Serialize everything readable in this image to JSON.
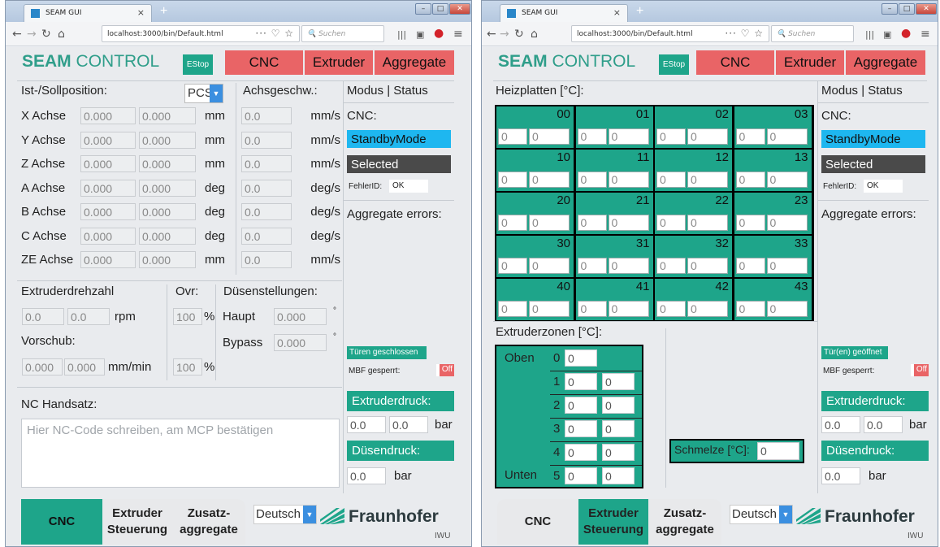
{
  "browser": {
    "tab_title": "SEAM GUI",
    "tab_close": "×",
    "new_tab": "+",
    "url": "localhost:3000/bin/Default.html",
    "url_menu": "··· ♡ ☆",
    "search_placeholder": "Suchen"
  },
  "header": {
    "logo_bold": "SEAM",
    "logo_rest": " CONTROL",
    "estop": "EStop",
    "btn_cnc": "CNC",
    "btn_extruder": "Extruder",
    "btn_aggregate": "Aggregate"
  },
  "left": {
    "pos_title": "Ist-/Sollposition:",
    "pcs": "PCS",
    "speed_title": "Achsgeschw.:",
    "axes": [
      {
        "name": "X Achse",
        "ist": "0.000",
        "soll": "0.000",
        "unit": "mm",
        "speed": "0.0",
        "speed_unit": "mm/s"
      },
      {
        "name": "Y Achse",
        "ist": "0.000",
        "soll": "0.000",
        "unit": "mm",
        "speed": "0.0",
        "speed_unit": "mm/s"
      },
      {
        "name": "Z Achse",
        "ist": "0.000",
        "soll": "0.000",
        "unit": "mm",
        "speed": "0.0",
        "speed_unit": "mm/s"
      },
      {
        "name": "A Achse",
        "ist": "0.000",
        "soll": "0.000",
        "unit": "deg",
        "speed": "0.0",
        "speed_unit": "deg/s"
      },
      {
        "name": "B Achse",
        "ist": "0.000",
        "soll": "0.000",
        "unit": "deg",
        "speed": "0.0",
        "speed_unit": "deg/s"
      },
      {
        "name": "C Achse",
        "ist": "0.000",
        "soll": "0.000",
        "unit": "deg",
        "speed": "0.0",
        "speed_unit": "deg/s"
      },
      {
        "name": "ZE Achse",
        "ist": "0.000",
        "soll": "0.000",
        "unit": "mm",
        "speed": "0.0",
        "speed_unit": "mm/s"
      }
    ],
    "extruder_speed_title": "Extruderdrehzahl",
    "ovr_title": "Ovr:",
    "nozzle_title": "Düsenstellungen:",
    "rpm_ist": "0.0",
    "rpm_soll": "0.0",
    "rpm_unit": "rpm",
    "ovr1": "100",
    "pct": "%",
    "haupt_label": "Haupt",
    "haupt_val": "0.000",
    "deg_sym": "°",
    "vorschub_title": "Vorschub:",
    "bypass_label": "Bypass",
    "bypass_val": "0.000",
    "feed_ist": "0.000",
    "feed_soll": "0.000",
    "feed_unit": "mm/min",
    "ovr2": "100",
    "nc_title": "NC Handsatz:",
    "nc_placeholder": "Hier NC-Code schreiben, am MCP bestätigen"
  },
  "status": {
    "title": "Modus | Status",
    "cnc_label": "CNC:",
    "mode": "StandbyMode",
    "selected": "Selected",
    "fehler_label": "FehlerID:",
    "fehler_val": "OK",
    "agg_errors": "Aggregate errors:",
    "door_left": "Türen geschlossen",
    "door_right": "Tür(en) geöffnet",
    "mbf_label": "MBF gesperrt:",
    "mbf_val": "Off",
    "extr_pressure_title": "Extruderdruck:",
    "extr_p1": "0.0",
    "extr_p2": "0.0",
    "bar": "bar",
    "nozzle_pressure_title": "Düsendruck:",
    "nozzle_p": "0.0"
  },
  "extruder": {
    "heat_title": "Heizplatten [°C]:",
    "plates": [
      {
        "id": "00",
        "a": "0",
        "b": "0"
      },
      {
        "id": "01",
        "a": "0",
        "b": "0"
      },
      {
        "id": "02",
        "a": "0",
        "b": "0"
      },
      {
        "id": "03",
        "a": "0",
        "b": "0"
      },
      {
        "id": "10",
        "a": "0",
        "b": "0"
      },
      {
        "id": "11",
        "a": "0",
        "b": "0"
      },
      {
        "id": "12",
        "a": "0",
        "b": "0"
      },
      {
        "id": "13",
        "a": "0",
        "b": "0"
      },
      {
        "id": "20",
        "a": "0",
        "b": "0"
      },
      {
        "id": "21",
        "a": "0",
        "b": "0"
      },
      {
        "id": "22",
        "a": "0",
        "b": "0"
      },
      {
        "id": "23",
        "a": "0",
        "b": "0"
      },
      {
        "id": "30",
        "a": "0",
        "b": "0"
      },
      {
        "id": "31",
        "a": "0",
        "b": "0"
      },
      {
        "id": "32",
        "a": "0",
        "b": "0"
      },
      {
        "id": "33",
        "a": "0",
        "b": "0"
      },
      {
        "id": "40",
        "a": "0",
        "b": "0"
      },
      {
        "id": "41",
        "a": "0",
        "b": "0"
      },
      {
        "id": "42",
        "a": "0",
        "b": "0"
      },
      {
        "id": "43",
        "a": "0",
        "b": "0"
      }
    ],
    "zones_title": "Extruderzonen [°C]:",
    "oben": "Oben",
    "unten": "Unten",
    "zones": [
      {
        "id": "0",
        "a": "0",
        "b": ""
      },
      {
        "id": "1",
        "a": "0",
        "b": "0"
      },
      {
        "id": "2",
        "a": "0",
        "b": "0"
      },
      {
        "id": "3",
        "a": "0",
        "b": "0"
      },
      {
        "id": "4",
        "a": "0",
        "b": "0"
      },
      {
        "id": "5",
        "a": "0",
        "b": "0"
      }
    ],
    "schmelze_label": "Schmelze [°C]:",
    "schmelze_val": "0"
  },
  "footer": {
    "tab_cnc": "CNC",
    "tab_extruder_1": "Extruder",
    "tab_extruder_2": "Steuerung",
    "tab_zusatz_1": "Zusatz-",
    "tab_zusatz_2": "aggregate",
    "language": "Deutsch",
    "brand": "Fraunhofer",
    "brand_sub": "IWU"
  },
  "colors": {
    "teal": "#1ea58a",
    "red_button": "#e96466",
    "blue_mode": "#1eb7f0",
    "selected_bg": "#4a4a4a"
  }
}
